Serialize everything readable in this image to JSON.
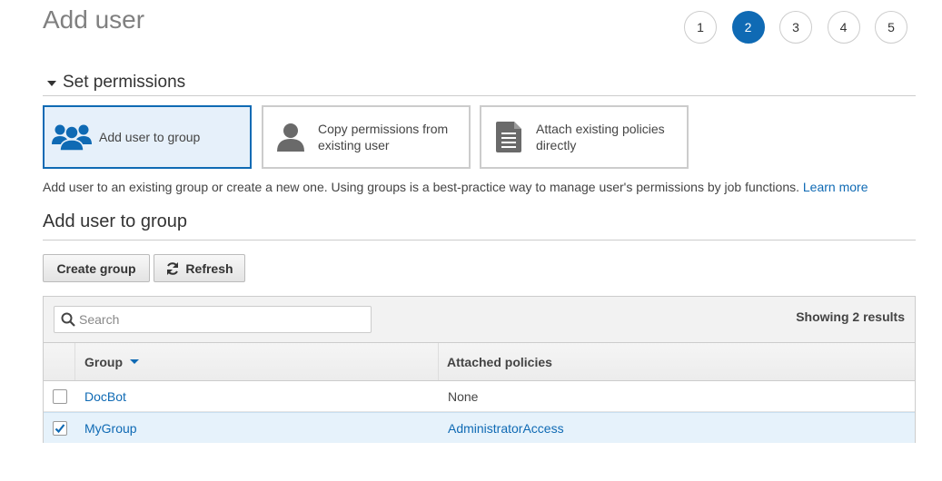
{
  "page": {
    "title": "Add user"
  },
  "steps": [
    "1",
    "2",
    "3",
    "4",
    "5"
  ],
  "active_step": "2",
  "permissions": {
    "section_title": "Set permissions",
    "options": [
      {
        "label": "Add user to group",
        "icon": "group-icon",
        "selected": true
      },
      {
        "label_line1": "Copy permissions from",
        "label_line2": "existing user",
        "icon": "user-icon",
        "selected": false
      },
      {
        "label_line1": "Attach existing policies",
        "label_line2": "directly",
        "icon": "document-icon",
        "selected": false
      }
    ],
    "help_text": "Add user to an existing group or create a new one. Using groups is a best-practice way to manage user's permissions by job functions.",
    "learn_more": "Learn more"
  },
  "group_section": {
    "title": "Add user to group",
    "create_group_label": "Create group",
    "refresh_label": "Refresh"
  },
  "table": {
    "search_placeholder": "Search",
    "results_text": "Showing 2 results",
    "columns": [
      "Group",
      "Attached policies"
    ],
    "rows": [
      {
        "group": "DocBot",
        "policies": "None",
        "checked": false
      },
      {
        "group": "MyGroup",
        "policies": "AdministratorAccess",
        "checked": true
      }
    ]
  },
  "colors": {
    "accent": "#0f6ab4",
    "selected_bg": "#e6f0fa"
  }
}
